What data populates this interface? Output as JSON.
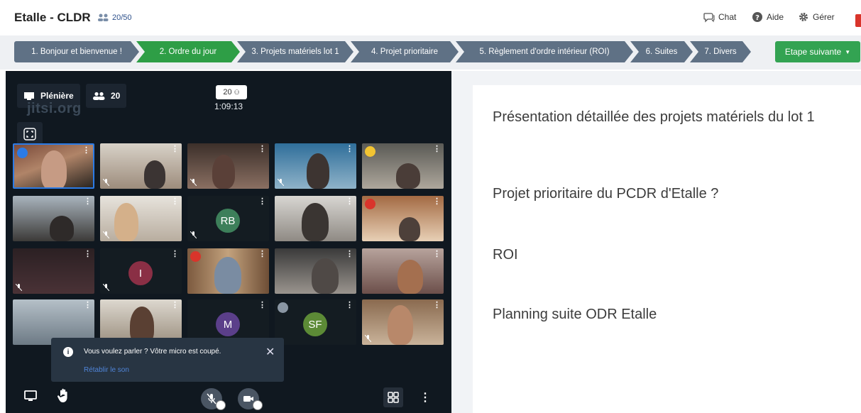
{
  "header": {
    "title": "Etalle - CLDR",
    "participants": "20/50",
    "chat_label": "Chat",
    "help_label": "Aide",
    "manage_label": "Gérer"
  },
  "steps": [
    {
      "label": "1. Bonjour et bienvenue !"
    },
    {
      "label": "2. Ordre du jour"
    },
    {
      "label": "3. Projets matériels lot 1"
    },
    {
      "label": "4. Projet prioritaire"
    },
    {
      "label": "5. Règlement d'ordre intérieur (ROI)"
    },
    {
      "label": "6. Suites"
    },
    {
      "label": "7. Divers"
    }
  ],
  "next_step_label": "Etape suivante",
  "video": {
    "room_label": "Plénière",
    "participant_count": "20",
    "watermark": "jitsi.org",
    "badge_count": "20",
    "timer": "1:09:13",
    "avatars": {
      "rb": "RB",
      "i": "I",
      "m": "M",
      "sf": "SF"
    },
    "toast": {
      "message": "Vous voulez parler ? Vôtre micro est coupé.",
      "link": "Rétablir le son"
    }
  },
  "agenda": [
    "Présentation détaillée des projets matériels du lot 1",
    "Projet prioritaire du PCDR d'Etalle ?",
    "ROI",
    "Planning suite ODR Etalle"
  ],
  "colors": {
    "step_default": "#5f7185",
    "step_active": "#2e9e46",
    "next_button": "#33a352",
    "video_bg": "#101820"
  }
}
